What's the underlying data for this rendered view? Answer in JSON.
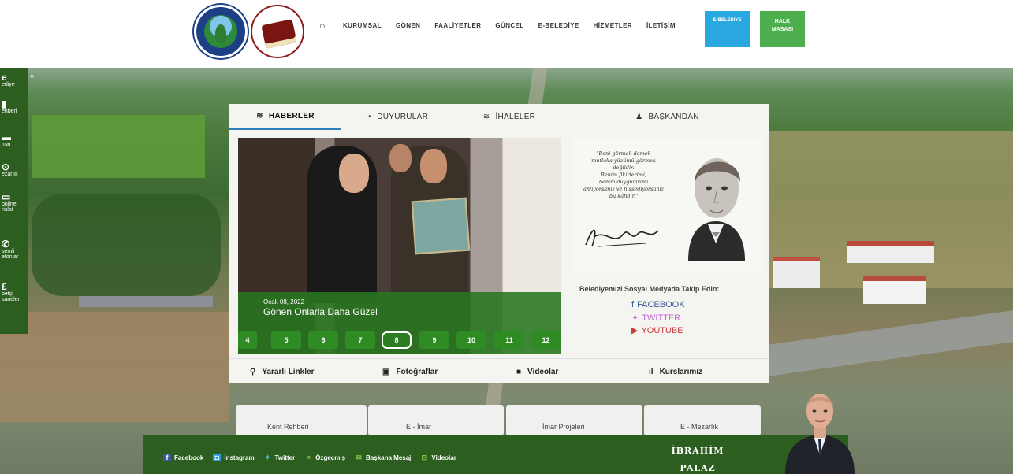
{
  "header": {
    "nav": [
      "KURUMSAL",
      "GÖNEN",
      "FAALİYETLER",
      "GÜNCEL",
      "E-BELEDİYE",
      "HİZMETLER",
      "İLETİŞİM"
    ],
    "btn_ebelediye": "E-BELEDİYE",
    "btn_halk_line1": "HALK",
    "btn_halk_line2": "MASASI"
  },
  "sidebar": {
    "items": [
      {
        "icon": "e",
        "label": "ediye"
      },
      {
        "icon": "▮",
        "label": "ehberi"
      },
      {
        "icon": "▬",
        "label": "mar"
      },
      {
        "icon": "⊙",
        "label": "ezarlık"
      },
      {
        "icon": "▭",
        "label": "online"
      },
      {
        "icon": "",
        "label": "rislat"
      },
      {
        "icon": "✆",
        "label": "semli"
      },
      {
        "icon": "",
        "label": "efonlar"
      },
      {
        "icon": "£",
        "label": "betçi"
      },
      {
        "icon": "",
        "label": "saneler"
      }
    ]
  },
  "tabs": [
    "HABERLER",
    "DUYURULAR",
    "İHALELER",
    "BAŞKANDAN"
  ],
  "news": {
    "date": "Ocak 08, 2022",
    "title": "Gönen Onlarla Daha Güzel",
    "pages": [
      "4",
      "5",
      "6",
      "7",
      "8",
      "9",
      "10",
      "11",
      "12"
    ],
    "active_page": "8"
  },
  "quote": {
    "lines": [
      "\"Beni görmek demek",
      "mutlaka yüzümü görmek",
      "değildir.",
      "Benim fikirlerimi,",
      "benim duygularımı",
      "anlıyorsanız ve hissediyorsanız",
      "bu kâfidir.\""
    ]
  },
  "social": {
    "title": "Belediyemizi Sosyal Medyada Takip Edin:",
    "facebook": "FACEBOOK",
    "twitter": "TWITTER",
    "youtube": "YOUTUBE"
  },
  "bottom_tabs": [
    "Yararlı Linkler",
    "Fotoğraflar",
    "Videolar",
    "Kurslarımız"
  ],
  "cards": [
    "Kent Rehberi",
    "E - İmar",
    "İmar Projeleri",
    "E - Mezarlık"
  ],
  "footer": {
    "links": [
      "Facebook",
      "İnstagram",
      "Twitter",
      "Özgeçmiş",
      "Başkana Mesaj",
      "Videolar"
    ],
    "mayor_first": "İBRAHİM",
    "mayor_last": "PALAZ"
  },
  "colors": {
    "green_dark": "#2c5f1f",
    "green": "#2f8b24",
    "blue": "#29a7df",
    "light_green": "#4cae4c"
  }
}
